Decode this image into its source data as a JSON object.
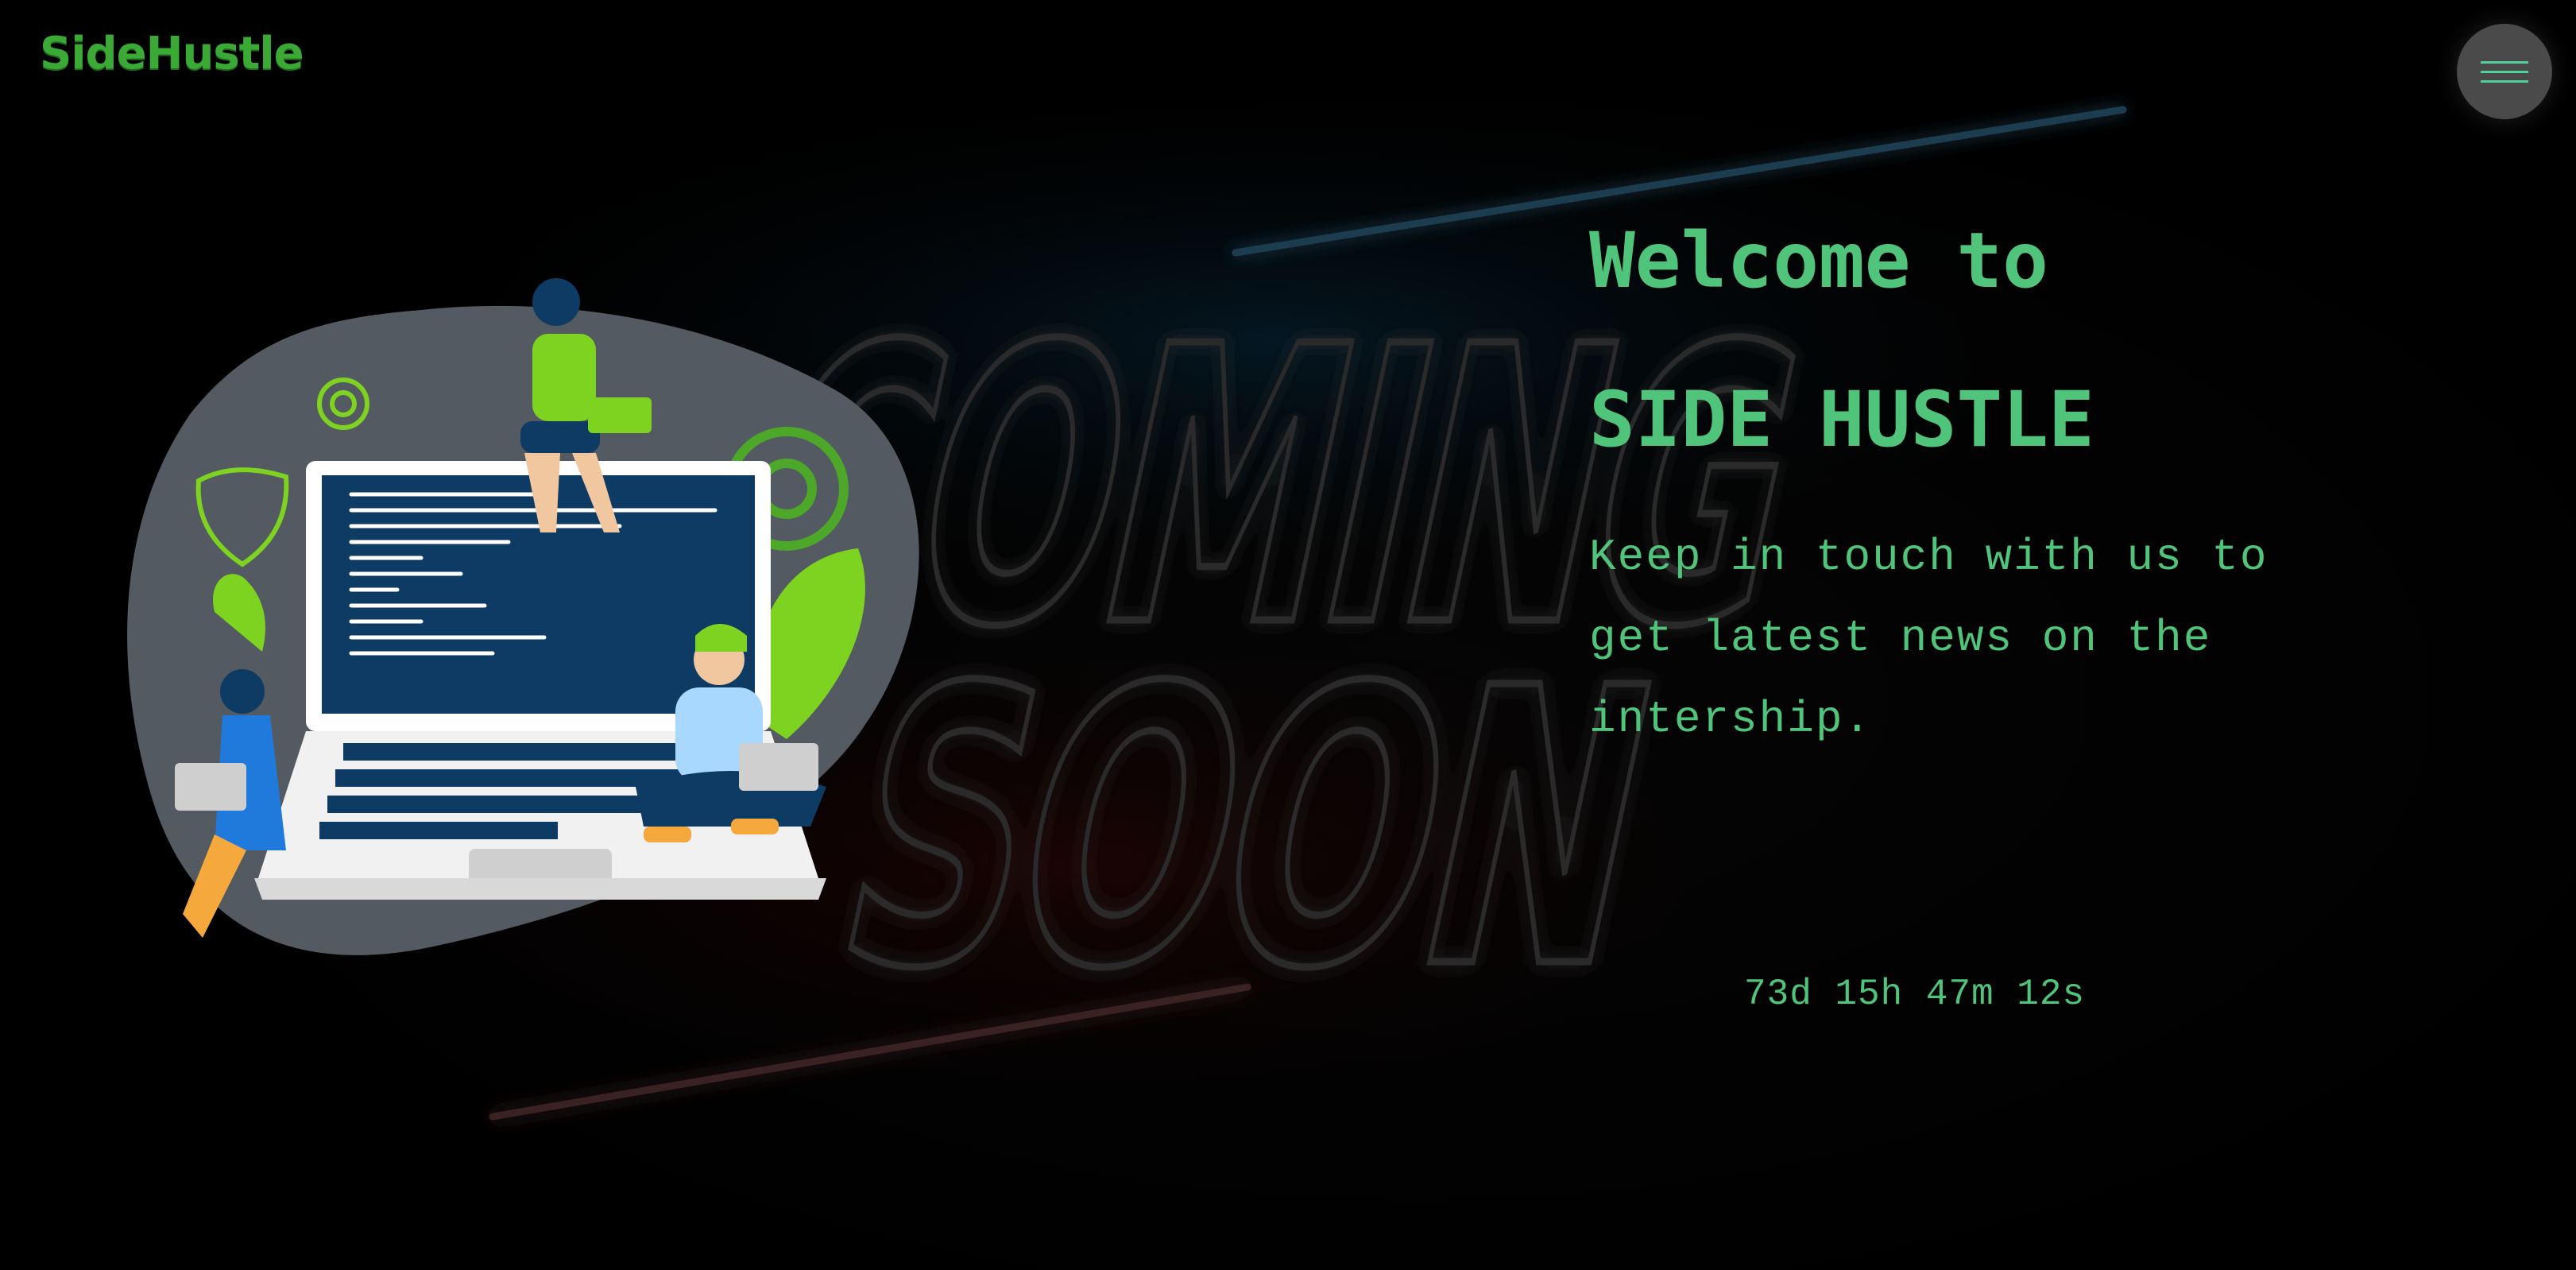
{
  "header": {
    "logo_text": "SideHustle",
    "menu_icon": "hamburger-menu-icon"
  },
  "background": {
    "sign_word_1": "COMING",
    "sign_word_2": "SOON"
  },
  "hero": {
    "title_line_1": "Welcome to",
    "title_line_2": "SIDE HUSTLE",
    "subtitle": "Keep in touch with us to get latest news on the intership."
  },
  "countdown": {
    "text": "73d 15h 47m 12s"
  },
  "colors": {
    "accent_green": "#4fc47a",
    "logo_green": "#3aa935",
    "background": "#000000",
    "menu_button": "#4a4a4a",
    "neon_blue": "#0a3a5a",
    "neon_red": "#5a0a0a"
  }
}
